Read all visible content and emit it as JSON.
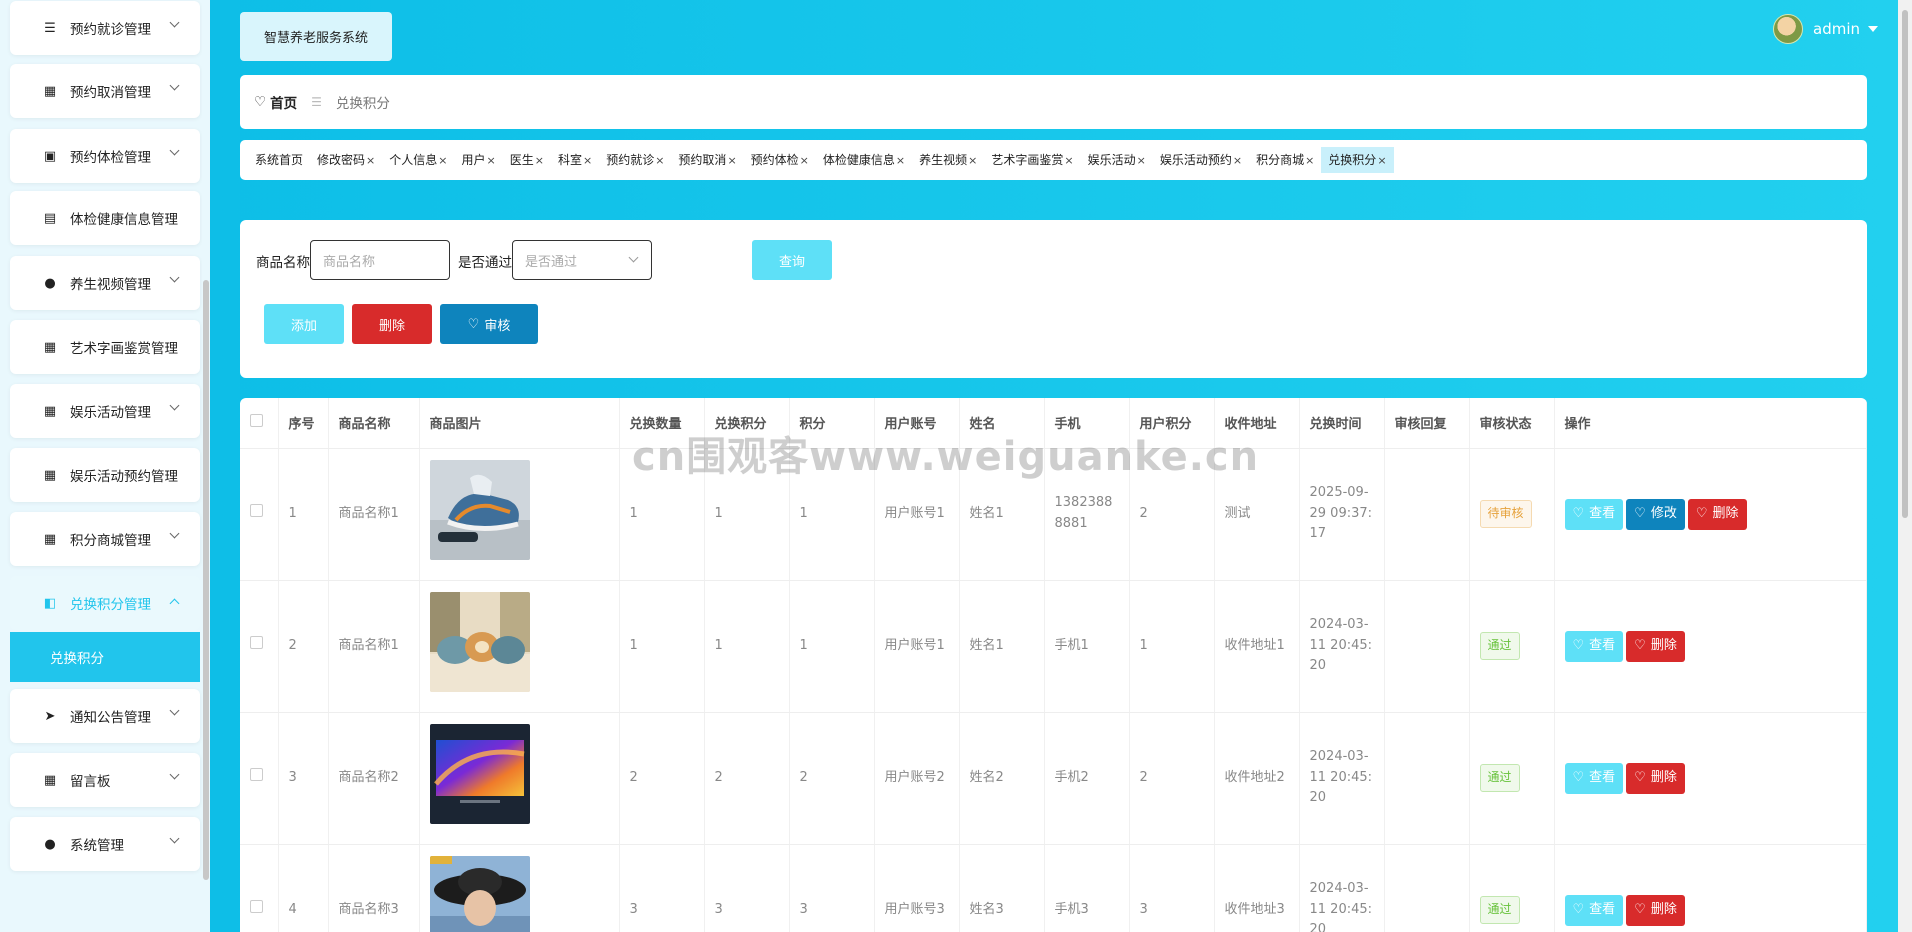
{
  "sidebar": {
    "items": [
      {
        "label": "预约就诊管理",
        "icon": "list-icon",
        "glyph": "☰",
        "has_chevron": true
      },
      {
        "label": "预约取消管理",
        "icon": "grid-icon",
        "glyph": "▦",
        "has_chevron": true
      },
      {
        "label": "预约体检管理",
        "icon": "briefcase-icon",
        "glyph": "▣",
        "has_chevron": true
      },
      {
        "label": "体检健康信息管理",
        "icon": "clipboard-icon",
        "glyph": "▤",
        "has_chevron": false
      },
      {
        "label": "养生视频管理",
        "icon": "bulb-icon",
        "glyph": "●",
        "has_chevron": true
      },
      {
        "label": "艺术字画鉴赏管理",
        "icon": "grid-icon",
        "glyph": "▦",
        "has_chevron": false
      },
      {
        "label": "娱乐活动管理",
        "icon": "grid-icon",
        "glyph": "▦",
        "has_chevron": true
      },
      {
        "label": "娱乐活动预约管理",
        "icon": "grid-icon",
        "glyph": "▦",
        "has_chevron": false
      },
      {
        "label": "积分商城管理",
        "icon": "grid-icon",
        "glyph": "▦",
        "has_chevron": true
      },
      {
        "label": "兑换积分管理",
        "icon": "exchange-icon",
        "glyph": "◧",
        "has_chevron": true,
        "active": true
      },
      {
        "label": "通知公告管理",
        "icon": "send-icon",
        "glyph": "➤",
        "has_chevron": true
      },
      {
        "label": "留言板",
        "icon": "grid-icon",
        "glyph": "▦",
        "has_chevron": true
      },
      {
        "label": "系统管理",
        "icon": "user-icon",
        "glyph": "●",
        "has_chevron": true
      }
    ],
    "submenu_label": "兑换积分"
  },
  "header": {
    "brand": "智慧养老服务系统",
    "username": "admin"
  },
  "breadcrumb": {
    "home": "首页",
    "separator": "☰",
    "current": "兑换积分"
  },
  "tabs": [
    {
      "label": "系统首页",
      "closable": false
    },
    {
      "label": "修改密码",
      "closable": true
    },
    {
      "label": "个人信息",
      "closable": true
    },
    {
      "label": "用户",
      "closable": true
    },
    {
      "label": "医生",
      "closable": true
    },
    {
      "label": "科室",
      "closable": true
    },
    {
      "label": "预约就诊",
      "closable": true
    },
    {
      "label": "预约取消",
      "closable": true
    },
    {
      "label": "预约体检",
      "closable": true
    },
    {
      "label": "体检健康信息",
      "closable": true
    },
    {
      "label": "养生视频",
      "closable": true
    },
    {
      "label": "艺术字画鉴赏",
      "closable": true
    },
    {
      "label": "娱乐活动",
      "closable": true
    },
    {
      "label": "娱乐活动预约",
      "closable": true
    },
    {
      "label": "积分商城",
      "closable": true
    },
    {
      "label": "兑换积分",
      "closable": true,
      "active": true
    }
  ],
  "search": {
    "name_label": "商品名称",
    "name_placeholder": "商品名称",
    "pass_label": "是否通过",
    "pass_placeholder": "是否通过",
    "query_button": "查询"
  },
  "actions": {
    "add": "添加",
    "delete": "删除",
    "audit": "审核"
  },
  "table": {
    "columns": [
      "",
      "序号",
      "商品名称",
      "商品图片",
      "兑换数量",
      "兑换积分",
      "积分",
      "用户账号",
      "姓名",
      "手机",
      "用户积分",
      "收件地址",
      "兑换时间",
      "审核回复",
      "审核状态",
      "操作"
    ],
    "rows": [
      {
        "index": "1",
        "product": "商品名称1",
        "image": "sneaker-image",
        "qty": "1",
        "points_used": "1",
        "points": "1",
        "account": "用户账号1",
        "name": "姓名1",
        "phone": "13823888881",
        "user_points": "2",
        "address": "测试",
        "time": "2025-09-29 09:37:17",
        "reply": "",
        "status": "待审核",
        "status_type": "pending",
        "ops": [
          "查看",
          "修改",
          "删除"
        ]
      },
      {
        "index": "2",
        "product": "商品名称1",
        "image": "pillows-image",
        "qty": "1",
        "points_used": "1",
        "points": "1",
        "account": "用户账号1",
        "name": "姓名1",
        "phone": "手机1",
        "user_points": "1",
        "address": "收件地址1",
        "time": "2024-03-11 20:45:20",
        "reply": "",
        "status": "通过",
        "status_type": "pass",
        "ops": [
          "查看",
          "删除"
        ]
      },
      {
        "index": "3",
        "product": "商品名称2",
        "image": "tv-image",
        "qty": "2",
        "points_used": "2",
        "points": "2",
        "account": "用户账号2",
        "name": "姓名2",
        "phone": "手机2",
        "user_points": "2",
        "address": "收件地址2",
        "time": "2024-03-11 20:45:20",
        "reply": "",
        "status": "通过",
        "status_type": "pass",
        "ops": [
          "查看",
          "删除"
        ]
      },
      {
        "index": "4",
        "product": "商品名称3",
        "image": "hat-image",
        "qty": "3",
        "points_used": "3",
        "points": "3",
        "account": "用户账号3",
        "name": "姓名3",
        "phone": "手机3",
        "user_points": "3",
        "address": "收件地址3",
        "time": "2024-03-11 20:45:20",
        "reply": "",
        "status": "通过",
        "status_type": "pass",
        "ops": [
          "查看",
          "删除"
        ]
      }
    ]
  },
  "watermark": "cn围观客www.weiguanke.cn",
  "colors": {
    "primary": "#21c5ec",
    "light_button": "#5ee0f7",
    "danger": "#d82b2b",
    "audit": "#0e84bd"
  }
}
